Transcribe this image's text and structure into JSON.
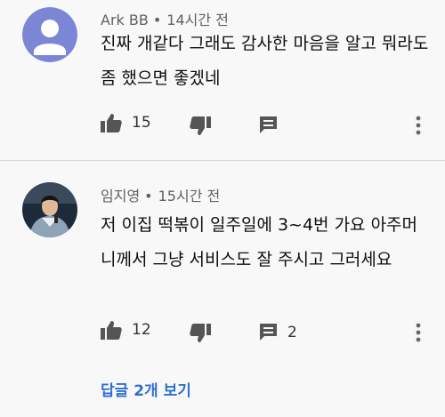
{
  "comments": [
    {
      "author": "Ark BB",
      "time": "14시간 전",
      "text": "진짜 개같다 그래도 감사한 마음을 알고 뭐라도 좀 했으면 좋겠네",
      "likes": "15",
      "replies": "",
      "avatar_icon": "default-person-avatar"
    },
    {
      "author": "임지영",
      "time": "15시간 전",
      "text": "저 이집 떡볶이 일주일에 3~4번 가요 아주머니께서 그냥 서비스도 잘 주시고 그러세요",
      "likes": "12",
      "replies": "2",
      "avatar_icon": "user-photo-avatar"
    }
  ],
  "separator": "•",
  "replies_link": "답글 2개 보기",
  "colors": {
    "link": "#2f6fcf",
    "default_avatar_bg": "#7b86d6"
  }
}
